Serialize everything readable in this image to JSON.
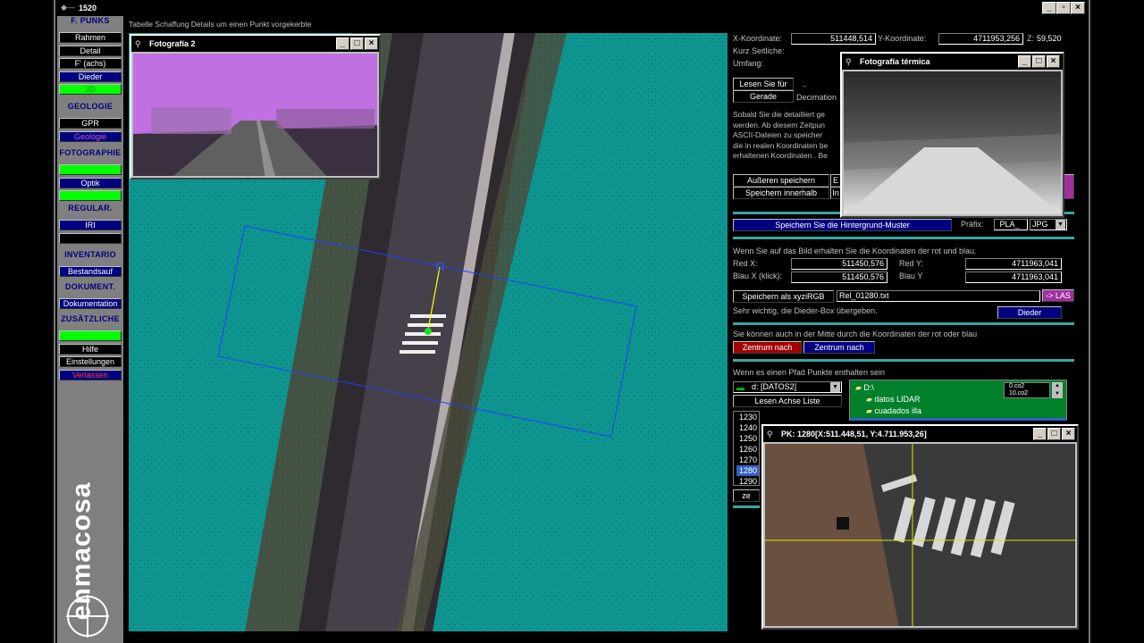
{
  "app": {
    "title": "1520"
  },
  "sidebar": {
    "sections": [
      {
        "title": "F. PUNKS",
        "items": [
          {
            "label": "Rahmen",
            "style": "blk"
          },
          {
            "label": "Detail",
            "style": "blk"
          },
          {
            "label": "F' (achs)",
            "style": "blk"
          },
          {
            "label": "Dieder",
            "style": "blu"
          },
          {
            "label": "3D",
            "style": "grn"
          }
        ]
      },
      {
        "title": "GEOLOGIE",
        "items": [
          {
            "label": "GPR",
            "style": "blk"
          },
          {
            "label": "Geologie",
            "style": "pur"
          }
        ]
      },
      {
        "title": "FOTOGRAPHIE",
        "items": [
          {
            "label": "",
            "style": "grn"
          },
          {
            "label": "Optik",
            "style": "blu"
          },
          {
            "label": "",
            "style": "grn"
          }
        ]
      },
      {
        "title": "REGULAR.",
        "items": [
          {
            "label": "IRI",
            "style": "blu"
          },
          {
            "label": "",
            "style": "blk"
          }
        ]
      },
      {
        "title": "INVENTARIO",
        "items": [
          {
            "label": "Bestandsauf",
            "style": "blu"
          }
        ]
      },
      {
        "title": "DOKUMENT.",
        "items": [
          {
            "label": "Dokumentation",
            "style": "blu"
          }
        ]
      },
      {
        "title": "ZUSÄTZLICHE",
        "items": [
          {
            "label": "",
            "style": "grn"
          },
          {
            "label": "Hilfe",
            "style": "blk"
          },
          {
            "label": "Einstellungen",
            "style": "blk"
          },
          {
            "label": "Verlassen",
            "style": "red"
          }
        ]
      }
    ],
    "logo_text": "enmacosa"
  },
  "main": {
    "title": "Tabelle Schaffung Details um einen Punkt vorgekerbte"
  },
  "coords": {
    "x_label": "X-Koordinate:",
    "x_value": "511448,514",
    "y_label": "Y-Koordinate:",
    "y_value": "4711953,256",
    "z_label": "Z:",
    "z_value": "59,520",
    "kurz_label": "Kurz Seitliche:",
    "umfang_label": "Umfang:",
    "dots": ".."
  },
  "actions": {
    "lesen_label": "Lesen Sie für",
    "gerade_label": "Gerade",
    "decimation_label": "Decimation",
    "description": [
      "Sobald Sie die detailliert ge",
      "werden. Ab diesem Zeitpun",
      "ASCII-Dateien zu speicher",
      "die in realen Koordinaten be",
      "erhaltenen Koordinaten . Be"
    ],
    "aussen_label": "Außeren speichern",
    "innen_label": "Speichern innerhalb",
    "aussen_suffix": "E",
    "innen_suffix": "In",
    "hintergrund_label": "Speichern Sie die Hintergrund-Muster",
    "prefix_label": "Präfix:",
    "prefix_value": "PLA_",
    "ext_value": "JPG"
  },
  "redblue": {
    "intro": "Wenn Sie auf das Bild erhalten Sie die Koordinaten der rot und blau.",
    "redx_label": "Red X:",
    "redx_value": "511450,576",
    "redy_label": "Red Y:",
    "redy_value": "4711963,041",
    "bluex_label": "Blau X (klick):",
    "bluex_value": "511450,576",
    "bluey_label": "Blau Y",
    "bluey_value": "4711963,041",
    "save_xyz_label": "Speichern als xyziRGB",
    "file_value": "Rel_01280.txt",
    "las_label": "-> LAS",
    "important": "Sehr wichtig, die Dieder-Box übergeben.",
    "dieder_label": "Dieder"
  },
  "center": {
    "text": "Sie können auch in der Mitte durch die Koordinaten der rot oder blau",
    "red_label": "Zentrum nach",
    "blue_label": "Zentrum nach"
  },
  "path": {
    "text": "Wenn es einen Pfad Punkte enthalten sein",
    "drive_value": "d: [DATOS2]",
    "read_axis_label": "Lesen Achse Liste",
    "tree": [
      "D:\\",
      "datos LIDAR",
      "cuadados illa"
    ],
    "mini_list": [
      "0.co2",
      "10.co2"
    ],
    "pk_list": [
      "1230",
      "1240",
      "1250",
      "1260",
      "1270",
      "1280",
      "1290"
    ],
    "selected_pk": "1280",
    "z_btn": "ze"
  },
  "windows": {
    "foto2": "Fotografía 2",
    "thermal": "Fotografía térmica",
    "pk": "PK: 1280[X:511.448,51, Y:4.711.953,26]"
  },
  "colors": {
    "map_bg": "#0e9590",
    "accent_green": "#00ff00",
    "panel_blue": "#000080"
  }
}
